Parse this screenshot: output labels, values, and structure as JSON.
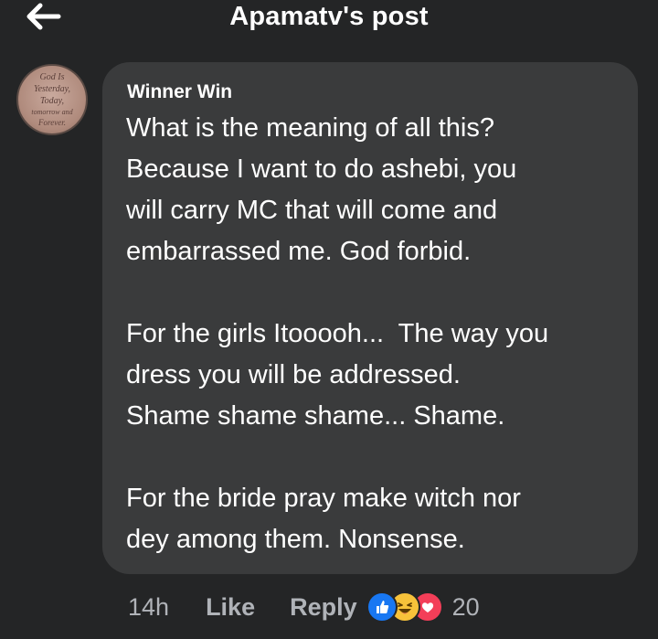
{
  "header": {
    "title": "Apamatv's post",
    "back_icon": "arrow-left-icon"
  },
  "comment": {
    "avatar_lines": [
      "God Is",
      "Yesterday,",
      "Today,",
      "tomorrow and",
      "Forever."
    ],
    "author": "Winner Win",
    "paragraphs": [
      [
        "What is the meaning of all this?",
        "Because I want to do ashebi, you",
        "will carry MC that will come and",
        "embarrassed me. God forbid."
      ],
      [
        "For the girls Itooooh...  The way you",
        "dress you will be addressed.",
        "Shame shame shame... Shame."
      ],
      [
        "For the bride pray make witch nor",
        "dey among them. Nonsense."
      ]
    ],
    "time": "14h",
    "like_label": "Like",
    "reply_label": "Reply",
    "reactions": [
      "like-reaction-icon",
      "haha-reaction-icon",
      "love-reaction-icon"
    ],
    "reaction_count": "20"
  },
  "colors": {
    "background": "#242526",
    "bubble": "#3a3b3c",
    "text": "#ffffff",
    "secondary_text": "#b0b3b8",
    "like_blue": "#1877f2",
    "haha_yellow": "#f7c23a",
    "love_red": "#f33e58"
  }
}
